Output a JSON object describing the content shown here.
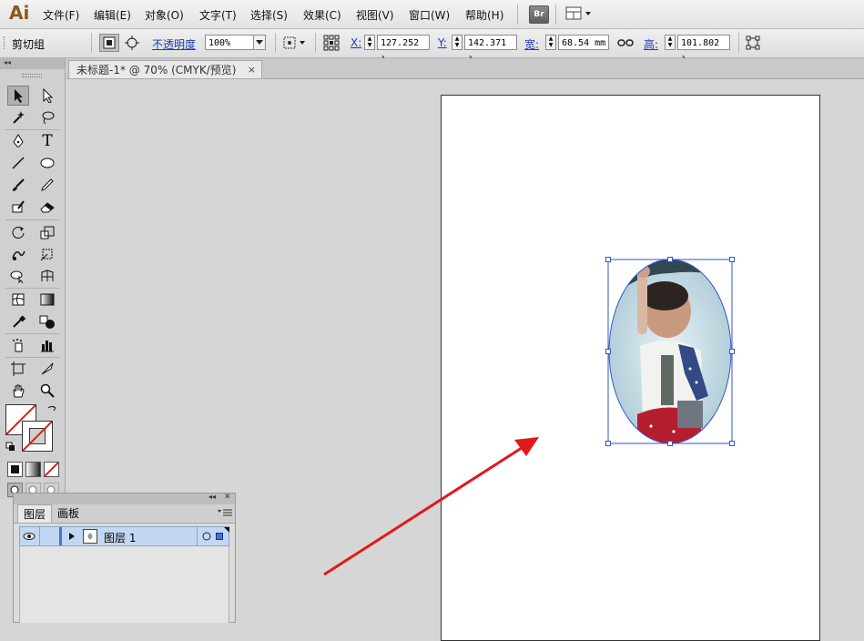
{
  "app": {
    "logo": "Ai"
  },
  "menu": {
    "items": [
      {
        "id": "file",
        "label": "文件(F)"
      },
      {
        "id": "edit",
        "label": "编辑(E)"
      },
      {
        "id": "object",
        "label": "对象(O)"
      },
      {
        "id": "type",
        "label": "文字(T)"
      },
      {
        "id": "select",
        "label": "选择(S)"
      },
      {
        "id": "effect",
        "label": "效果(C)"
      },
      {
        "id": "view",
        "label": "视图(V)"
      },
      {
        "id": "window",
        "label": "窗口(W)"
      },
      {
        "id": "help",
        "label": "帮助(H)"
      }
    ],
    "bridge_label": "Br"
  },
  "control_bar": {
    "selection_type": "剪切组",
    "opacity_label": "不透明度",
    "opacity_value": "100%",
    "x_label": "X:",
    "x_value": "127.252 ı",
    "y_label": "Y:",
    "y_value": "142.371 ı",
    "w_label": "宽:",
    "w_value": "68.54 mm",
    "h_label": "高:",
    "h_value": "101.802 ı"
  },
  "document": {
    "tab_title": "未标题-1* @ 70% (CMYK/预览)",
    "close_glyph": "×"
  },
  "tools": {
    "header_glyph": "◂◂",
    "type_tool_glyph": "T"
  },
  "layers_panel": {
    "header_glyph": "◂◂",
    "close_glyph": "✕",
    "tabs": [
      "图层",
      "画板"
    ],
    "layers": [
      {
        "name": "图层 1"
      }
    ]
  },
  "colors": {
    "selection_accent": "#3355cc",
    "arrow": "#e11919",
    "layer_highlight": "#c4d7f2"
  }
}
